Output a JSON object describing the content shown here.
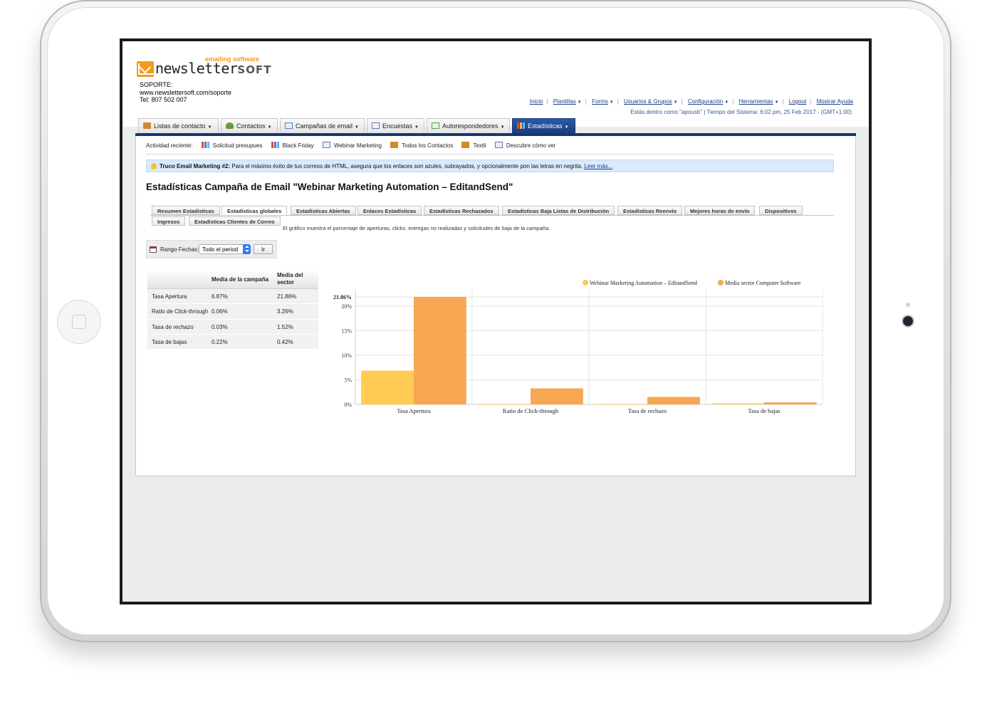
{
  "logo": {
    "tagline": "emailing software",
    "name": "newsletter",
    "name_suffix": "SOFT"
  },
  "support": {
    "label": "SOPORTE:",
    "url": "www.newslettersoft.com/soporte",
    "phone": "Tel: 807 502 007"
  },
  "toplinks": [
    "Inicio",
    "Plantillas",
    "Forms",
    "Usuarios & Grupos",
    "Configuración",
    "Herramientas",
    "Logout",
    "Mostrar Ayuda"
  ],
  "sysinfo": "Estás dentro como \"apousb\" | Tiempo del Sistema: 6:02 pm, 25 Feb 2017 - (GMT+1:00)",
  "nav": [
    {
      "label": "Listas de contacto",
      "icon": "contact-list-icon",
      "color": "#d28a2a"
    },
    {
      "label": "Contactos",
      "icon": "contacts-icon",
      "color": "#6a9a3a"
    },
    {
      "label": "Campañas de email",
      "icon": "email-campaign-icon",
      "color": "#5a7fb8"
    },
    {
      "label": "Encuestas",
      "icon": "survey-icon",
      "color": "#5a7fb8"
    },
    {
      "label": "Autorespondedores",
      "icon": "autoresponder-icon",
      "color": "#5a9a5a"
    },
    {
      "label": "Estadísticas",
      "icon": "statistics-icon",
      "color": "#e04a3a"
    }
  ],
  "recent": {
    "label": "Actividad reciente:",
    "items": [
      {
        "label": "Solicitud presupues",
        "icon": "bar-chart-icon"
      },
      {
        "label": "Black Friday",
        "icon": "bar-chart-icon"
      },
      {
        "label": "Webinar Marketing",
        "icon": "email-icon"
      },
      {
        "label": "Todos los Contactos",
        "icon": "contact-list-icon"
      },
      {
        "label": "Textil",
        "icon": "contact-list-icon"
      },
      {
        "label": "Descubre cómo ver",
        "icon": "email-icon"
      }
    ]
  },
  "tip": {
    "title": "Truco Email Marketing #2:",
    "text": " Para el máximo éxito de tus correos de HTML, asegura que los enlaces son azules, subrayados, y opcionalmente pon las letras en negrita. ",
    "link": "Leer más..."
  },
  "page_title": "Estadísticas Campaña de Email \"Webinar Marketing Automation – EditandSend\"",
  "subtabs_row1": [
    "Resumen Estadísticas",
    "Estadísticas globales",
    "Estadísticas Abiertas",
    "Enlaces Estadísticas",
    "Estadísticas Rechazados",
    "Estadísticas Baja Listas de Distribución",
    "Estadísticas Reenvío",
    "Mejores horas de envío",
    "Dispositivos"
  ],
  "subtabs_row2": [
    "Ingresos",
    "Estadísticas Clientes de Correo"
  ],
  "active_subtab": "Estadísticas globales",
  "chart_description": "El gráfico muestra el porcentaje de aperturas, clicks, entregas no realizadas y solicitudes de baja de la campaña.",
  "range": {
    "label": "Rango Fechas:",
    "selected": "Todo el period",
    "button": "Ir"
  },
  "stats_table": {
    "headers": [
      "",
      "Media de la campaña",
      "Media del sector"
    ],
    "rows": [
      [
        "Tasa Apertura",
        "6.87%",
        "21.86%"
      ],
      [
        "Ratio de Click-through",
        "0.06%",
        "3.26%"
      ],
      [
        "Tasa de rechazo",
        "0.03%",
        "1.52%"
      ],
      [
        "Tasa de bajas",
        "0.22%",
        "0.42%"
      ]
    ]
  },
  "chart_data": {
    "type": "bar",
    "categories": [
      "Tasa Apertura",
      "Ratio de Click-through",
      "Tasa de rechazo",
      "Tasa de bajas"
    ],
    "series": [
      {
        "name": "Webinar Marketing Automation – EditandSend",
        "values": [
          6.87,
          0.06,
          0.03,
          0.22
        ],
        "color": "#ffcb52"
      },
      {
        "name": "Media sector Computer Software",
        "values": [
          21.86,
          3.26,
          1.52,
          0.42
        ],
        "color": "#f7a752"
      }
    ],
    "y_ticks": [
      "0%",
      "5%",
      "10%",
      "15%",
      "20%"
    ],
    "y_tick_values": [
      0,
      5,
      10,
      15,
      20
    ],
    "y_max_label": "21.86%",
    "ylim": [
      0,
      21.86
    ],
    "grid": true,
    "legend": "top-right"
  }
}
